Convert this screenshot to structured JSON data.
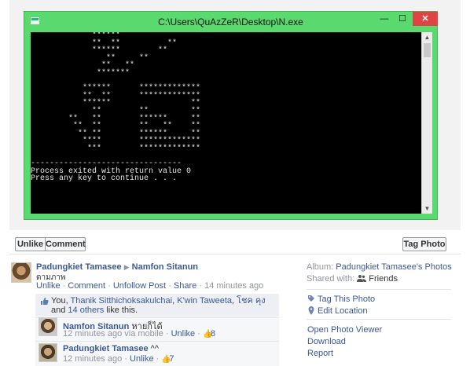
{
  "console": {
    "window_title": "C:\\Users\\QuAzZeR\\Desktop\\N.exe",
    "min_glyph": "—",
    "max_glyph": "☐",
    "close_glyph": "✕",
    "output": "             ******\n             **  **          **\n             ******        **\n                **     **\n               **   **\n              *******\n\n           ******      *************\n           **  **      *************\n           ******                 **\n             **        **         **\n        **   **        ******     **\n         **  **        **   **    **\n          ** **        ******     **\n           ****        *************\n            ***        *************\n\n--------------------------------\nProcess exited with return value 0\nPress any key to continue . . .",
    "scroll_up": "▲",
    "scroll_down": "▼"
  },
  "actions": {
    "unlike": "Unlike",
    "comment": "Comment",
    "tag_photo": "Tag Photo"
  },
  "post": {
    "author": "Padungkiet Tamasee",
    "arrow": "▶",
    "target": "Namfon Sitanun",
    "caption": "ดามภาพ",
    "links": [
      "Unlike",
      "Comment",
      "Unfollow Post",
      "Share"
    ],
    "sep": "·",
    "time": "14 minutes ago"
  },
  "likes": {
    "prefix": "You, ",
    "names": [
      "Thanik Sitthichoksakulchai",
      "K'win Taweeta",
      "โชค คุง"
    ],
    "and_text": " and ",
    "others": "14 others",
    "suffix": " like this.",
    "comma": ", "
  },
  "comments": [
    {
      "author": "Namfon Sitanun",
      "text": " หายก็ได้",
      "time": "12 minutes ago via mobile",
      "unlike": "Unlike",
      "likes": "8"
    },
    {
      "author": "Padungkiet Tamasee",
      "text": " ^^",
      "time": "12 minutes ago",
      "unlike": "Unlike",
      "likes": "7"
    }
  ],
  "sidebar": {
    "album_label": "Album: ",
    "album_name": "Padungkiet Tamasee's Photos",
    "shared_label": "Shared with: ",
    "shared_value": "Friends",
    "tag_this_photo": "Tag This Photo",
    "edit_location": "Edit Location",
    "open_photo_viewer": "Open Photo Viewer",
    "download": "Download",
    "report": "Report"
  }
}
